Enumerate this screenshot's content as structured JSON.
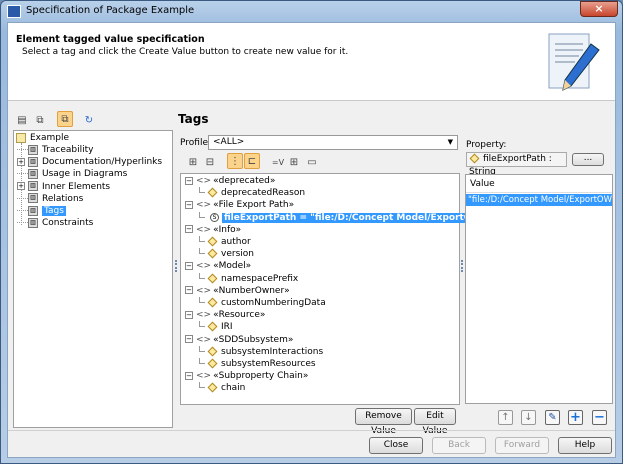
{
  "window": {
    "title": "Specification of Package Example",
    "close_icon": "×"
  },
  "header": {
    "title": "Element tagged value specification",
    "subtitle": "Select a tag and click the Create Value button to create new value for it."
  },
  "left_tree": {
    "root": "Example",
    "items": [
      {
        "label": "Traceability",
        "expandable": false
      },
      {
        "label": "Documentation/Hyperlinks",
        "expandable": true
      },
      {
        "label": "Usage in Diagrams",
        "expandable": false
      },
      {
        "label": "Inner Elements",
        "expandable": true
      },
      {
        "label": "Relations",
        "expandable": false
      },
      {
        "label": "Tags",
        "expandable": false,
        "selected": true
      },
      {
        "label": "Constraints",
        "expandable": false
      }
    ]
  },
  "tags": {
    "heading": "Tags",
    "profile_label": "Profile:",
    "profile_value": "<ALL>",
    "rows": [
      {
        "text": "«deprecated»",
        "level": 0
      },
      {
        "text": "deprecatedReason",
        "level": 1
      },
      {
        "text": "«File Export Path»",
        "level": 0
      },
      {
        "text": "fileExportPath = \"file:/D:/Concept Model/ExportOWL\"",
        "level": 1,
        "selected": true
      },
      {
        "text": "«Info»",
        "level": 0
      },
      {
        "text": "author",
        "level": 1
      },
      {
        "text": "version",
        "level": 1
      },
      {
        "text": "«Model»",
        "level": 0
      },
      {
        "text": "namespacePrefix",
        "level": 1
      },
      {
        "text": "«NumberOwner»",
        "level": 0
      },
      {
        "text": "customNumberingData",
        "level": 1
      },
      {
        "text": "«Resource»",
        "level": 0
      },
      {
        "text": "IRI",
        "level": 1
      },
      {
        "text": "«SDDSubsystem»",
        "level": 0
      },
      {
        "text": "subsystemInteractions",
        "level": 1
      },
      {
        "text": "subsystemResources",
        "level": 1
      },
      {
        "text": "«Subproperty Chain»",
        "level": 0
      },
      {
        "text": "chain",
        "level": 1
      }
    ],
    "stereo_mark": "<>",
    "remove_value": "Remove Value",
    "edit_value": "Edit Value"
  },
  "property": {
    "label": "Property:",
    "value": "fileExportPath : String",
    "browse": "...",
    "value_header": "Value",
    "values": [
      "\"file:/D:/Concept Model/ExportOWL\""
    ]
  },
  "footer": {
    "close": "Close",
    "back": "Back",
    "forward": "Forward",
    "help": "Help"
  }
}
